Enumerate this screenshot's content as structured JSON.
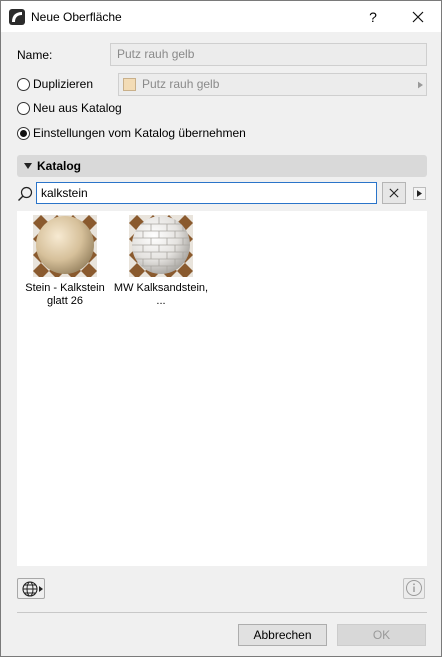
{
  "window": {
    "title": "Neue Oberfläche",
    "help_label": "?"
  },
  "name_field": {
    "label": "Name:",
    "value": "Putz rauh gelb"
  },
  "options": {
    "duplicate_label": "Duplizieren",
    "duplicate_value": "Putz rauh gelb",
    "duplicate_swatch_color": "#f3dcb6",
    "new_from_catalog_label": "Neu aus Katalog",
    "take_settings_label": "Einstellungen vom Katalog übernehmen",
    "selected": "take_settings"
  },
  "catalog": {
    "section_label": "Katalog",
    "search_value": "kalkstein",
    "results": [
      {
        "name": "Stein - Kalkstein glatt 26",
        "thumbnail": "smooth-limestone-sphere"
      },
      {
        "name": "MW Kalksandstein, ...",
        "thumbnail": "brick-sphere"
      }
    ]
  },
  "footer": {
    "cancel_label": "Abbrechen",
    "ok_label": "OK"
  },
  "icons": {
    "app": "archicad-icon",
    "search": "search-icon",
    "clear": "clear-x-icon",
    "expand": "triangle-right-icon",
    "globe": "globe-icon",
    "info": "info-icon"
  },
  "colors": {
    "focus_border": "#2a74c9",
    "section_bar": "#d9d9d9"
  }
}
